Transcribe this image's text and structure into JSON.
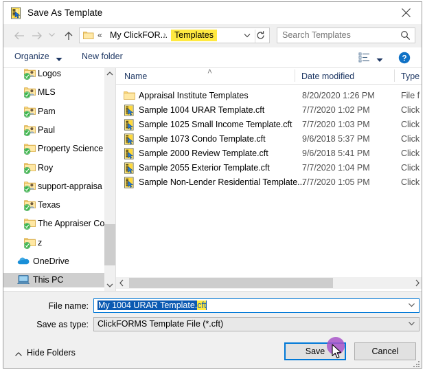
{
  "window": {
    "title": "Save As Template",
    "app_icon": "clickforms-template-icon",
    "close_label": "✕"
  },
  "navbar": {
    "back_icon": "arrow-left-icon",
    "forward_icon": "arrow-right-icon",
    "recent_icon": "chevron-down-icon",
    "up_icon": "arrow-up-icon",
    "address": {
      "folder_icon": "folder-icon",
      "overflow": "«",
      "crumb1": "My ClickFOR...",
      "separator": "›",
      "crumb2": "Templates",
      "crumb2_highlight": "#ffe940",
      "dropdown_icon": "chevron-down-icon",
      "refresh_icon": "refresh-icon"
    },
    "search": {
      "placeholder": "Search Templates",
      "icon": "search-icon"
    }
  },
  "commandbar": {
    "organize": "Organize",
    "organize_caret": "▼",
    "new_folder": "New folder",
    "view_icon": "view-layout-icon",
    "view_caret": "▼",
    "help_icon": "help-icon"
  },
  "navpane": {
    "items": [
      {
        "label": "Logos",
        "icon": "shared-folder-icon",
        "indent": true,
        "selected": false
      },
      {
        "label": "MLS",
        "icon": "shared-folder-icon",
        "indent": true,
        "selected": false
      },
      {
        "label": "Pam",
        "icon": "shared-folder-icon",
        "indent": true,
        "selected": false
      },
      {
        "label": "Paul",
        "icon": "shared-folder-icon",
        "indent": true,
        "selected": false
      },
      {
        "label": "Property Science",
        "icon": "synced-folder-icon",
        "indent": true,
        "selected": false
      },
      {
        "label": "Roy",
        "icon": "synced-folder-icon",
        "indent": true,
        "selected": false
      },
      {
        "label": "support-appraisa",
        "icon": "shared-folder-icon",
        "indent": true,
        "selected": false
      },
      {
        "label": "Texas",
        "icon": "shared-folder-icon",
        "indent": true,
        "selected": false
      },
      {
        "label": "The Appraiser Co",
        "icon": "synced-folder-icon",
        "indent": true,
        "selected": false
      },
      {
        "label": "z",
        "icon": "synced-folder-icon",
        "indent": true,
        "selected": false
      },
      {
        "label": "OneDrive",
        "icon": "onedrive-cloud-icon",
        "indent": false,
        "selected": false
      },
      {
        "label": "This PC",
        "icon": "this-pc-icon",
        "indent": false,
        "selected": true
      }
    ],
    "scrollbar": {
      "up_icon": "chevron-up-icon",
      "down_icon": "chevron-down-icon"
    }
  },
  "filepane": {
    "columns": [
      "Name",
      "Date modified",
      "Type"
    ],
    "sort_indicator": "˄",
    "rows": [
      {
        "name": "Appraisal Institute Templates",
        "date": "8/20/2020 1:26 PM",
        "type": "File f",
        "icon": "folder-icon"
      },
      {
        "name": "Sample 1004 URAR Template.cft",
        "date": "7/7/2020 1:02 PM",
        "type": "Click",
        "icon": "cft-file-icon"
      },
      {
        "name": "Sample 1025 Small Income Template.cft",
        "date": "7/7/2020 1:03 PM",
        "type": "Click",
        "icon": "cft-file-icon"
      },
      {
        "name": "Sample 1073 Condo Template.cft",
        "date": "9/6/2018 5:37 PM",
        "type": "Click",
        "icon": "cft-file-icon"
      },
      {
        "name": "Sample 2000 Review Template.cft",
        "date": "9/6/2018 5:41 PM",
        "type": "Click",
        "icon": "cft-file-icon"
      },
      {
        "name": "Sample 2055 Exterior Template.cft",
        "date": "7/7/2020 1:04 PM",
        "type": "Click",
        "icon": "cft-file-icon"
      },
      {
        "name": "Sample Non-Lender Residential Template...",
        "date": "7/7/2020 1:05 PM",
        "type": "Click",
        "icon": "cft-file-icon"
      }
    ],
    "hscroll": {
      "left_icon": "chevron-left-icon",
      "right_icon": "chevron-right-icon"
    }
  },
  "form": {
    "filename_label": "File name:",
    "filename_value_base": "My 1004 URAR Template.",
    "filename_value_ext": "cft",
    "filename_value_full": "My 1004 URAR Template.cft",
    "filename_selection_color": "#0b59b2",
    "filename_ext_highlight": "#ffe940",
    "savetype_label": "Save as type:",
    "savetype_value": "ClickFORMS Template File (*.cft)",
    "caret_icon": "chevron-down-icon"
  },
  "footer": {
    "hide_folders": "Hide Folders",
    "hide_folders_caret": "˄",
    "save": "Save",
    "cancel": "Cancel",
    "click_marker_color": "#a855c9",
    "focus_color": "#0078d7"
  }
}
